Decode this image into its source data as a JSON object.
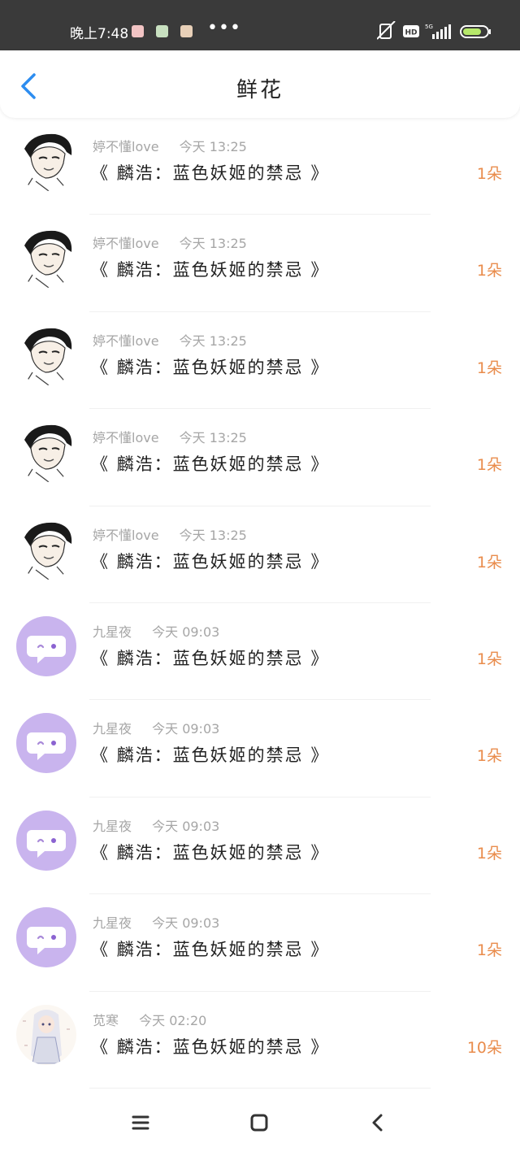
{
  "status_bar": {
    "time": "晚上7:48",
    "more": "•••",
    "network": "5G",
    "hd": "HD"
  },
  "header": {
    "title": "鲜花"
  },
  "list": [
    {
      "name": "婷不懂love",
      "time": "今天 13:25",
      "title": "《 麟浩：蓝色妖姬的禁忌 》",
      "count": "1朵",
      "avatar": "anime-character-avatar"
    },
    {
      "name": "婷不懂love",
      "time": "今天 13:25",
      "title": "《 麟浩：蓝色妖姬的禁忌 》",
      "count": "1朵",
      "avatar": "anime-character-avatar"
    },
    {
      "name": "婷不懂love",
      "time": "今天 13:25",
      "title": "《 麟浩：蓝色妖姬的禁忌 》",
      "count": "1朵",
      "avatar": "anime-character-avatar"
    },
    {
      "name": "婷不懂love",
      "time": "今天 13:25",
      "title": "《 麟浩：蓝色妖姬的禁忌 》",
      "count": "1朵",
      "avatar": "anime-character-avatar"
    },
    {
      "name": "婷不懂love",
      "time": "今天 13:25",
      "title": "《 麟浩：蓝色妖姬的禁忌 》",
      "count": "1朵",
      "avatar": "anime-character-avatar"
    },
    {
      "name": "九星夜",
      "time": "今天 09:03",
      "title": "《 麟浩：蓝色妖姬的禁忌 》",
      "count": "1朵",
      "avatar": "default-chat-avatar"
    },
    {
      "name": "九星夜",
      "time": "今天 09:03",
      "title": "《 麟浩：蓝色妖姬的禁忌 》",
      "count": "1朵",
      "avatar": "default-chat-avatar"
    },
    {
      "name": "九星夜",
      "time": "今天 09:03",
      "title": "《 麟浩：蓝色妖姬的禁忌 》",
      "count": "1朵",
      "avatar": "default-chat-avatar"
    },
    {
      "name": "九星夜",
      "time": "今天 09:03",
      "title": "《 麟浩：蓝色妖姬的禁忌 》",
      "count": "1朵",
      "avatar": "default-chat-avatar"
    },
    {
      "name": "苋寒",
      "time": "今天 02:20",
      "title": "《 麟浩：蓝色妖姬的禁忌 》",
      "count": "10朵",
      "avatar": "illustrated-girl-avatar"
    }
  ],
  "colors": {
    "accent": "#2d8df0",
    "count": "#e98c4c",
    "default_avatar_bg": "#c9b4ee",
    "status_bar": "#3a3a3a"
  }
}
